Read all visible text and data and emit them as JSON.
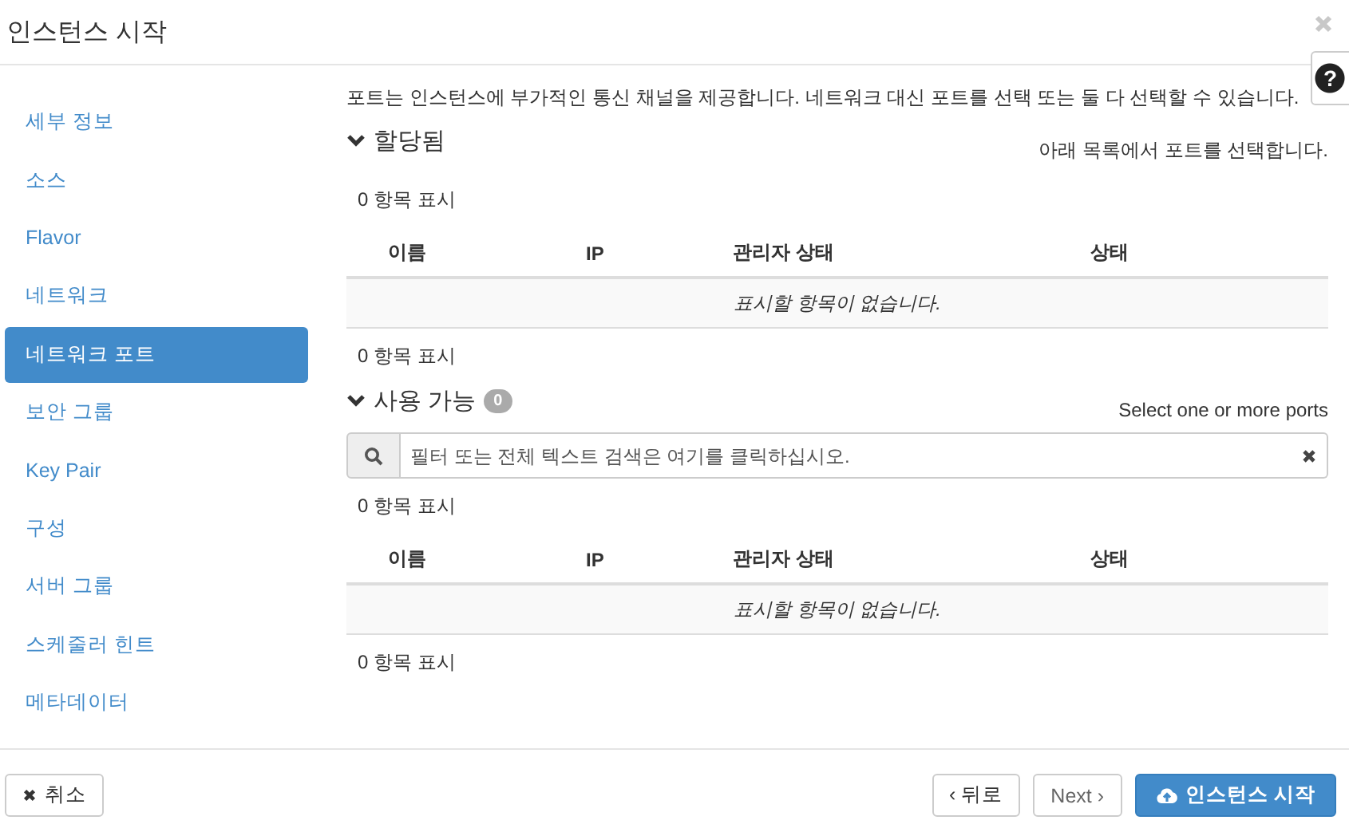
{
  "window": {
    "title": "인스턴스 시작",
    "help": "?"
  },
  "sidebar": {
    "items": [
      {
        "label": "세부 정보",
        "selected": false
      },
      {
        "label": "소스",
        "selected": false
      },
      {
        "label": "Flavor",
        "selected": false
      },
      {
        "label": "네트워크",
        "selected": false
      },
      {
        "label": "네트워크 포트",
        "selected": true
      },
      {
        "label": "보안 그룹",
        "selected": false
      },
      {
        "label": "Key Pair",
        "selected": false
      },
      {
        "label": "구성",
        "selected": false
      },
      {
        "label": "서버 그룹",
        "selected": false
      },
      {
        "label": "스케줄러 힌트",
        "selected": false
      },
      {
        "label": "메타데이터",
        "selected": false
      }
    ]
  },
  "description": "포트는 인스턴스에 부가적인 통신 채널을 제공합니다. 네트워크 대신 포트를 선택 또는 둘 다 선택할 수 있습니다.",
  "sections": [
    {
      "title": "할당됨",
      "expanded": true,
      "hint": "아래 목록에서 포트를 선택합니다.",
      "count_top": "0 항목 표시",
      "columns": [
        "이름",
        "IP",
        "관리자 상태",
        "상태"
      ],
      "empty_message": "표시할 항목이 없습니다.",
      "count_bottom": "0 항목 표시"
    },
    {
      "title": "사용 가능",
      "expanded": true,
      "badge": "0",
      "hint": "Select one or more ports",
      "search": {
        "placeholder": "필터 또는 전체 텍스트 검색은 여기를 클릭하십시오."
      },
      "count_top": "0 항목 표시",
      "columns": [
        "이름",
        "IP",
        "관리자 상태",
        "상태"
      ],
      "empty_message": "표시할 항목이 없습니다.",
      "count_bottom": "0 항목 표시"
    }
  ],
  "footer": {
    "cancel": "취소",
    "back": "‹ 뒤로",
    "next": "Next ›",
    "launch": "인스턴스 시작"
  }
}
